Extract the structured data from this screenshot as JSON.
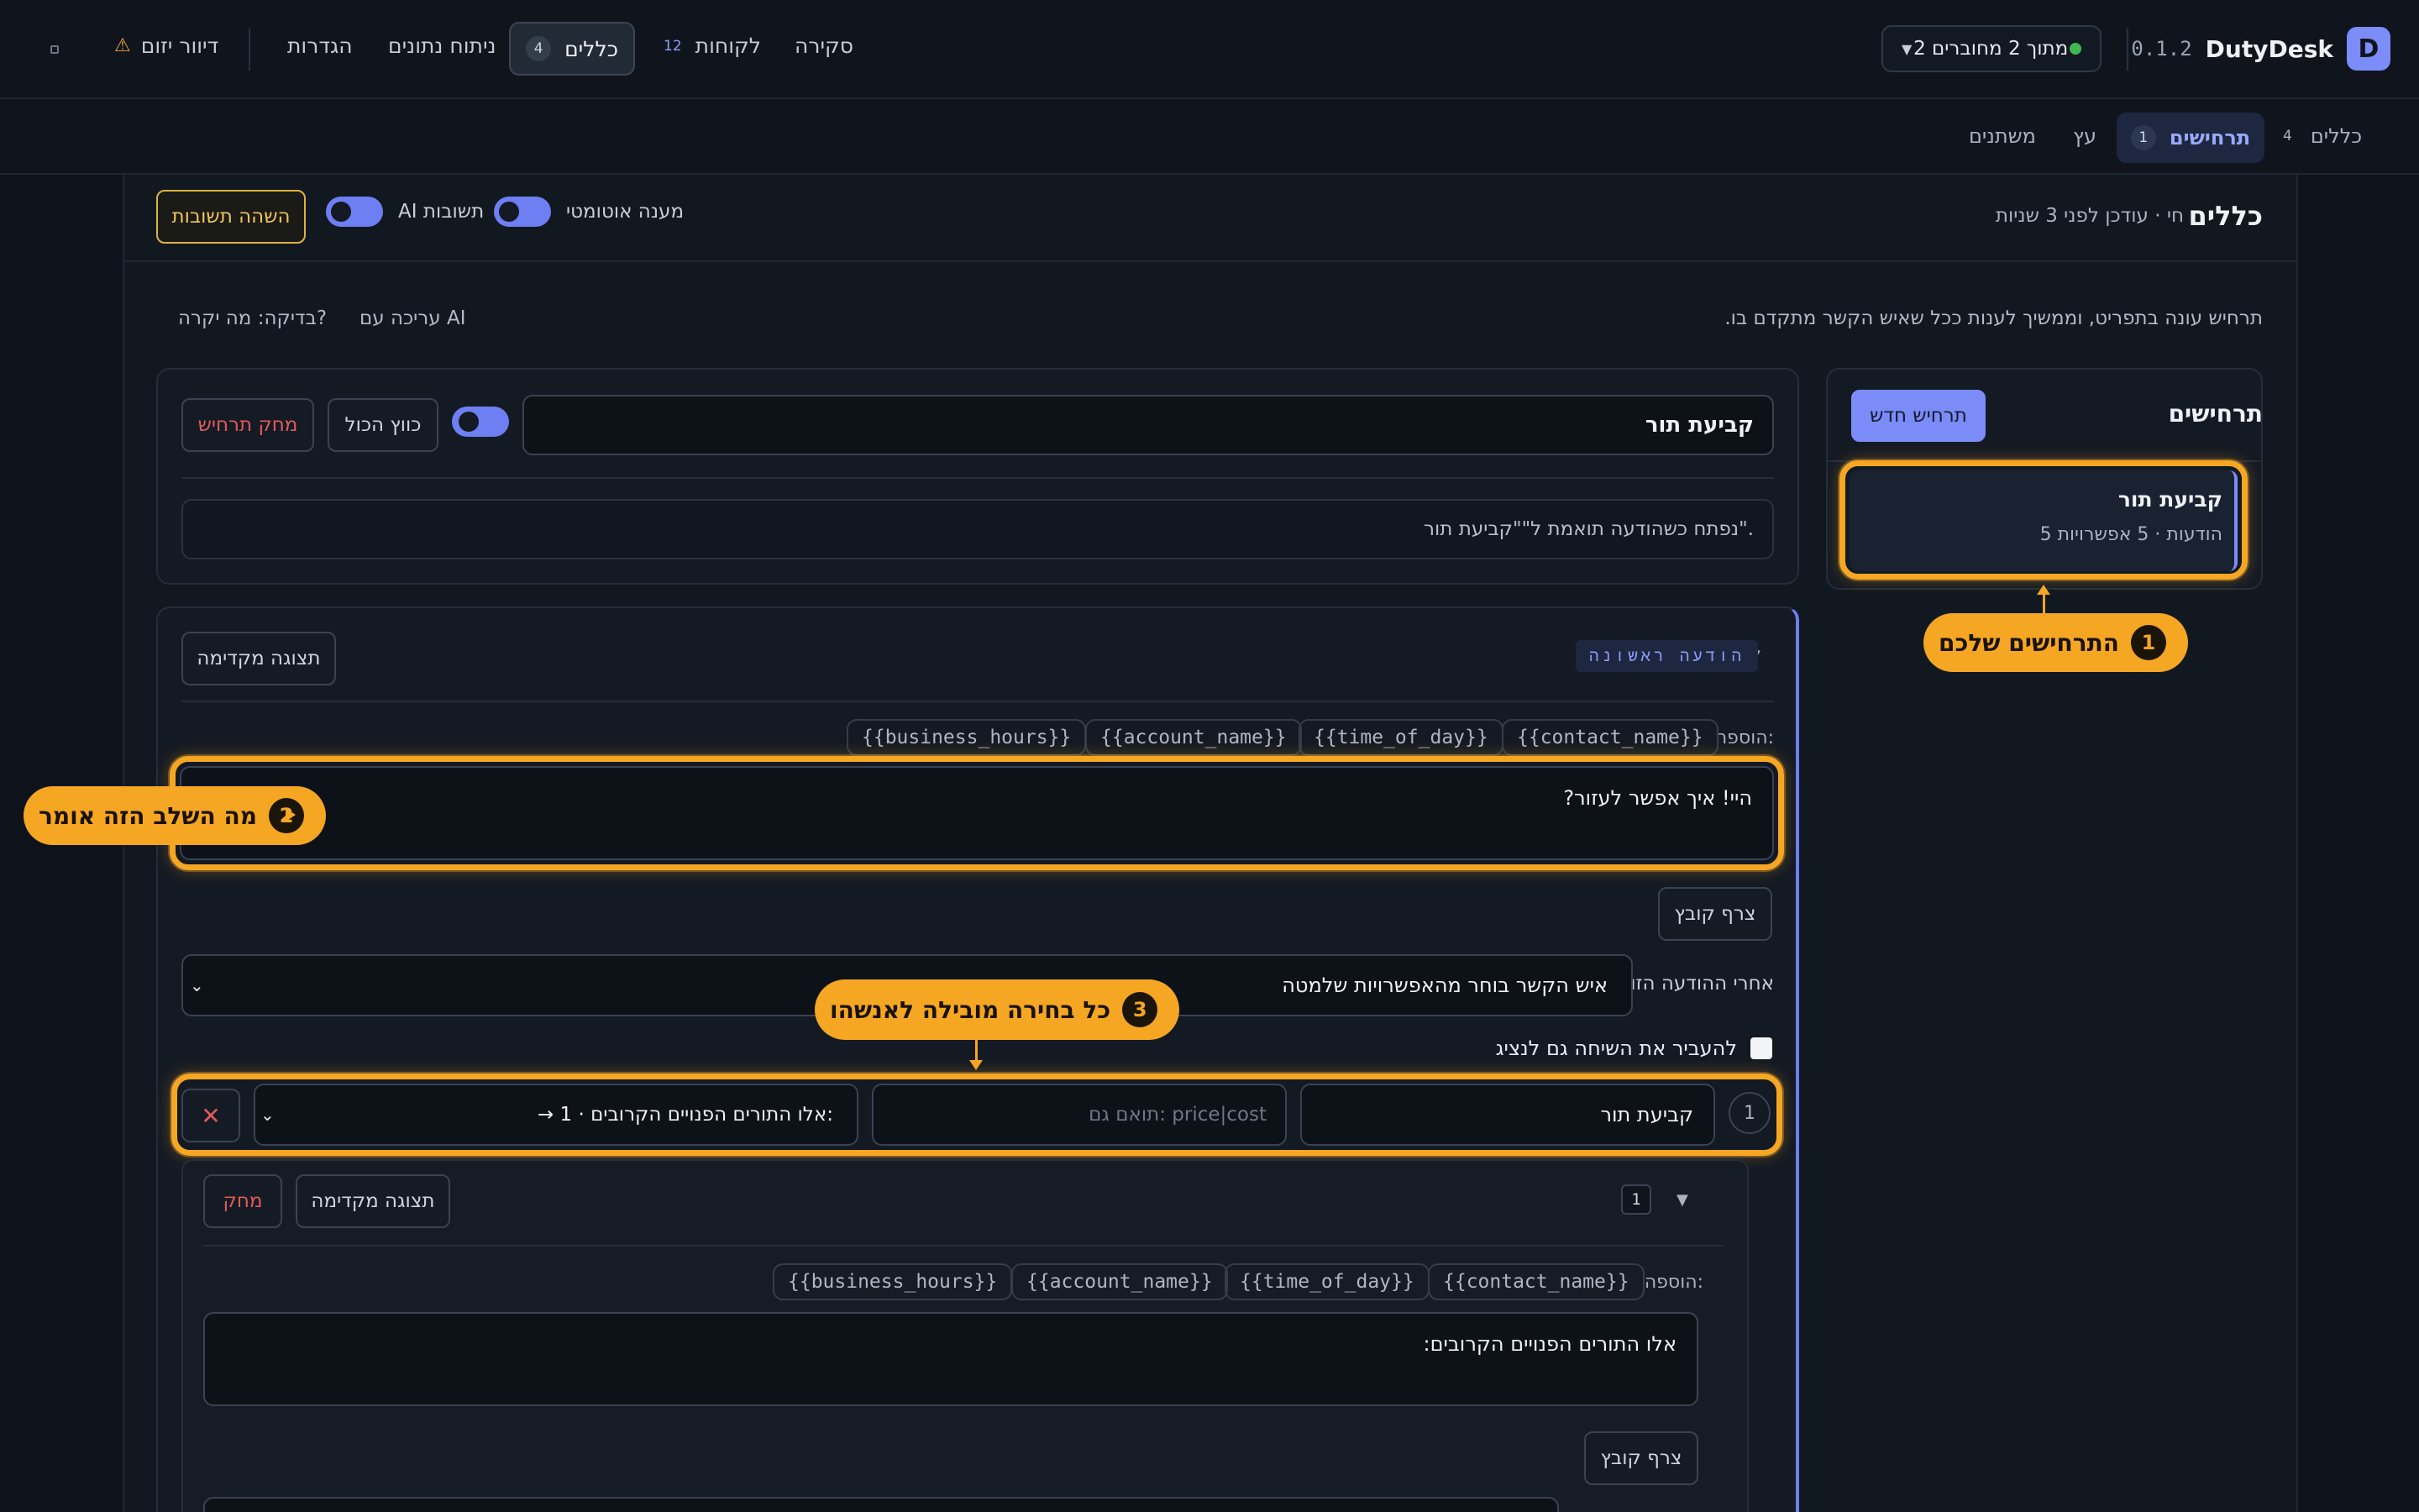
{
  "app": {
    "brand": "DutyDesk",
    "version": "0.1.2",
    "logo_letter": "D"
  },
  "connection": {
    "label": "2 מתוך 2 מחוברים",
    "status_color": "#3fb950"
  },
  "nav": {
    "items": [
      {
        "label": "סקירה"
      },
      {
        "label": "לקוחות",
        "badge": "12"
      },
      {
        "label": "כללים",
        "badge": "4"
      },
      {
        "label": "ניתוח נתונים"
      },
      {
        "label": "הגדרות"
      },
      {
        "label": "דיוור יזום"
      }
    ]
  },
  "subtabs": [
    {
      "label": "כללים",
      "badge": "4"
    },
    {
      "label": "תרחישים",
      "badge": "1"
    },
    {
      "label": "עץ"
    },
    {
      "label": "משתנים"
    }
  ],
  "panel": {
    "title": "כללים",
    "status": "חי · עודכן לפני 3 שניות",
    "auto_reply_label": "מענה אוטומטי",
    "ai_answers_label": "תשובות AI",
    "pause_button": "השהה תשובות",
    "description": "תרחיש עונה בתפריט, וממשיך לענות ככל שאיש הקשר מתקדם בו.",
    "edit_ai": "עריכה עם AI",
    "test_label": "בדיקה: מה יקרה?"
  },
  "scenarios": {
    "title": "תרחישים",
    "new_button": "תרחיש חדש",
    "items": [
      {
        "name": "קביעת תור",
        "meta": "5 הודעות · 5 אפשרויות"
      }
    ]
  },
  "editor": {
    "name_value": "קביעת תור",
    "collapse_button": "כווץ הכול",
    "delete_button": "מחק תרחיש",
    "trigger_text": "נפתח כשהודעה תואמת ל\"\"קביעת תור\".",
    "first_message_tag": "הודעה ראשונה",
    "preview_button": "תצוגה מקדימה",
    "insert_label": "הוספה:",
    "variables": [
      "{{contact_name}}",
      "{{time_of_day}}",
      "{{account_name}}",
      "{{business_hours}}"
    ],
    "message_text": "היי! איך אפשר לעזור?",
    "attach_button": "צרף קובץ",
    "after_label": "אחרי ההודעה הזו",
    "after_select": "איש הקשר בוחר מהאפשרויות שלמטה",
    "transfer_label": "להעביר את השיחה גם לנציג",
    "option": {
      "number": "1",
      "label_value": "קביעת תור",
      "match_placeholder": "תואם גם: price|cost",
      "target": "→ 1 · אלו התורים הפנויים הקרובים:"
    },
    "step": {
      "number": "1",
      "delete_button": "מחק",
      "preview_button": "תצוגה מקדימה",
      "insert_label": "הוספה:",
      "message_text": "אלו התורים הפנויים הקרובים:",
      "attach_button": "צרף קובץ"
    }
  },
  "callouts": [
    {
      "number": "1",
      "text": "התרחישים שלכם"
    },
    {
      "number": "2",
      "text": "מה השלב הזה אומר"
    },
    {
      "number": "3",
      "text": "כל בחירה מובילה לאנשהו"
    }
  ]
}
